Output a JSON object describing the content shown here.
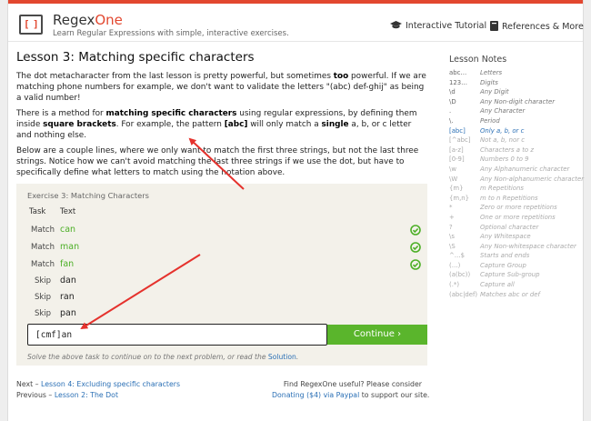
{
  "header": {
    "logo_left": "[",
    "logo_right": "]",
    "brand_main": "Regex",
    "brand_accent": "One",
    "tagline": "Learn Regular Expressions with simple, interactive exercises.",
    "nav_tutorial": "Interactive Tutorial",
    "nav_refs": "References & More"
  },
  "lesson": {
    "title": "Lesson 3: Matching specific characters",
    "p1_a": "The dot metacharacter from the last lesson is pretty powerful, but sometimes ",
    "p1_bold": "too",
    "p1_b": " powerful. If we are matching phone numbers for example, we don't want to validate the letters \"(abc) def-ghij\" as being a valid number!",
    "p2_a": "There is a method for ",
    "p2_bold1": "matching specific characters",
    "p2_b": " using regular expressions, by defining them inside ",
    "p2_bold2": "square brackets",
    "p2_c": ". For example, the pattern ",
    "p2_bold3": "[abc]",
    "p2_d": " will only match a ",
    "p2_bold4": "single",
    "p2_e": " a, b, or c letter and nothing else.",
    "p3": "Below are a couple lines, where we only want to match the first three strings, but not the last three strings. Notice how we can't avoid matching the last three strings if we use the dot, but have to specifically define what letters to match using the notation above."
  },
  "exercise": {
    "title": "Exercise 3: Matching Characters",
    "col_task": "Task",
    "col_text": "Text",
    "rows": [
      {
        "task": "Match",
        "text": "can",
        "kind": "match"
      },
      {
        "task": "Match",
        "text": "man",
        "kind": "match"
      },
      {
        "task": "Match",
        "text": "fan",
        "kind": "match"
      },
      {
        "task": "Skip",
        "text": "dan",
        "kind": "skip"
      },
      {
        "task": "Skip",
        "text": "ran",
        "kind": "skip"
      },
      {
        "task": "Skip",
        "text": "pan",
        "kind": "skip"
      }
    ],
    "input_value": "[cmf]an",
    "continue_label": "Continue ›",
    "hint_a": "Solve the above task to continue on to the next problem, or read the ",
    "hint_link": "Solution",
    "hint_b": "."
  },
  "footer": {
    "next_prefix": "Next – ",
    "next_link": "Lesson 4: Excluding specific characters",
    "prev_prefix": "Previous – ",
    "prev_link": "Lesson 2: The Dot",
    "useful": "Find RegexOne useful? Please consider",
    "donate_link": "Donating ($4) via Paypal",
    "donate_suffix": " to support our site."
  },
  "notes": {
    "title": "Lesson Notes",
    "items": [
      {
        "sym": "abc…",
        "desc": "Letters",
        "state": "normal"
      },
      {
        "sym": "123…",
        "desc": "Digits",
        "state": "normal"
      },
      {
        "sym": "\\d",
        "desc": "Any Digit",
        "state": "normal"
      },
      {
        "sym": "\\D",
        "desc": "Any Non-digit character",
        "state": "normal"
      },
      {
        "sym": ".",
        "desc": "Any Character",
        "state": "normal"
      },
      {
        "sym": "\\.",
        "desc": "Period",
        "state": "normal"
      },
      {
        "sym": "[abc]",
        "desc": "Only a, b, or c",
        "state": "hl"
      },
      {
        "sym": "[^abc]",
        "desc": "Not a, b, nor c",
        "state": "dim"
      },
      {
        "sym": "[a-z]",
        "desc": "Characters a to z",
        "state": "dim"
      },
      {
        "sym": "[0-9]",
        "desc": "Numbers 0 to 9",
        "state": "dim"
      },
      {
        "sym": "\\w",
        "desc": "Any Alphanumeric character",
        "state": "dim"
      },
      {
        "sym": "\\W",
        "desc": "Any Non-alphanumeric character",
        "state": "dim"
      },
      {
        "sym": "{m}",
        "desc": "m Repetitions",
        "state": "dim"
      },
      {
        "sym": "{m,n}",
        "desc": "m to n Repetitions",
        "state": "dim"
      },
      {
        "sym": "*",
        "desc": "Zero or more repetitions",
        "state": "dim"
      },
      {
        "sym": "+",
        "desc": "One or more repetitions",
        "state": "dim"
      },
      {
        "sym": "?",
        "desc": "Optional character",
        "state": "dim"
      },
      {
        "sym": "\\s",
        "desc": "Any Whitespace",
        "state": "dim"
      },
      {
        "sym": "\\S",
        "desc": "Any Non-whitespace character",
        "state": "dim"
      },
      {
        "sym": "^…$",
        "desc": "Starts and ends",
        "state": "dim"
      },
      {
        "sym": "(…)",
        "desc": "Capture Group",
        "state": "dim"
      },
      {
        "sym": "(a(bc))",
        "desc": "Capture Sub-group",
        "state": "dim"
      },
      {
        "sym": "(.*)",
        "desc": "Capture all",
        "state": "dim"
      },
      {
        "sym": "(abc|def)",
        "desc": "Matches abc or def",
        "state": "dim"
      }
    ]
  },
  "colors": {
    "accent": "#e2472f",
    "match_green": "#4caf26",
    "button_green": "#5ab52c",
    "link_blue": "#2a6fb5",
    "annotation_red": "#e5322d"
  },
  "icons": {
    "tutorial": "graduation-cap-icon",
    "refs": "book-icon",
    "check": "check-circle-icon"
  }
}
